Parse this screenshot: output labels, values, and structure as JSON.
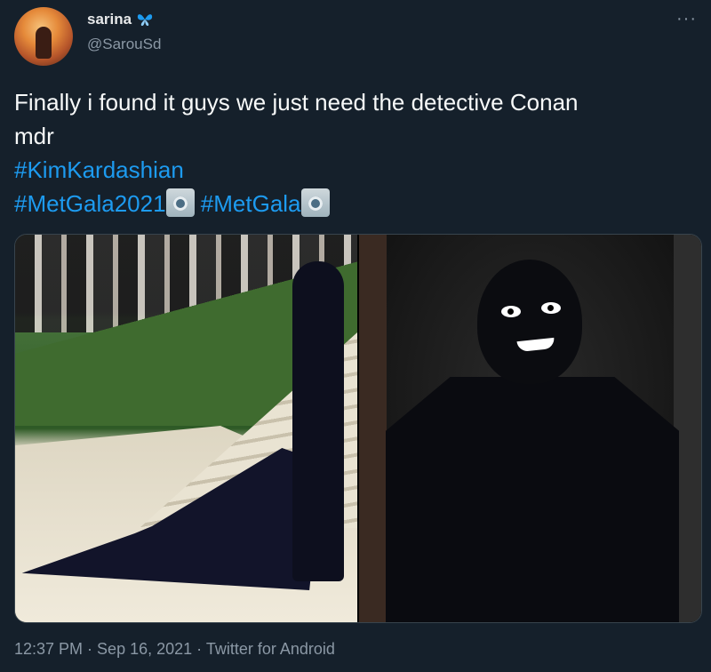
{
  "user": {
    "display_name": "sarina",
    "name_icon": "butterfly-icon",
    "handle": "@SarouSd",
    "more_label": "···"
  },
  "tweet": {
    "line1": "Finally i found it guys we just need the detective Conan",
    "line2": "mdr",
    "hashtags": [
      "#KimKardashian",
      "#MetGala2021",
      "#MetGala"
    ],
    "emoji": "camera-with-flash-icon"
  },
  "meta": {
    "time": "12:37 PM",
    "separator": " · ",
    "date": "Sep 16, 2021",
    "client": "Twitter for Android"
  },
  "colors": {
    "background": "#15202b",
    "hashtag": "#1d9bf0",
    "secondary_text": "#8b98a5"
  }
}
